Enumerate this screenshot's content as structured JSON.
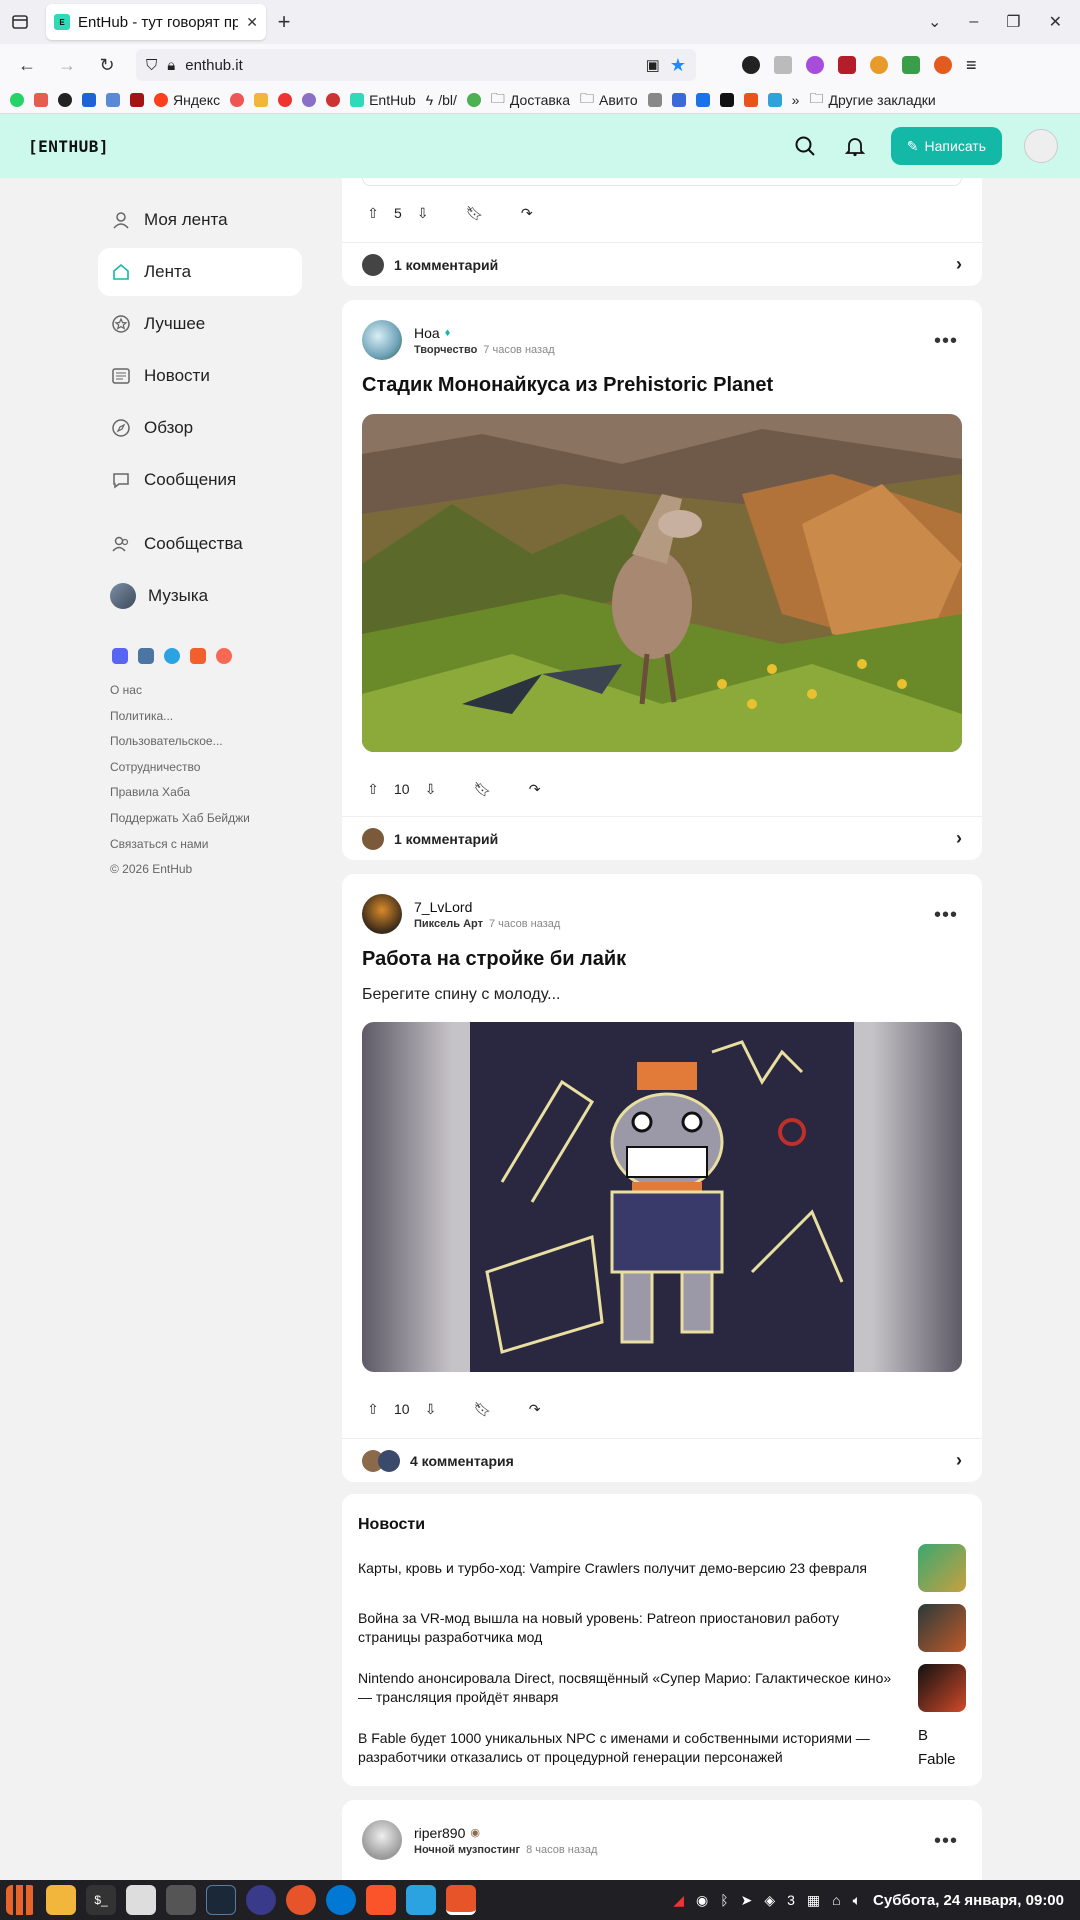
{
  "browser": {
    "tab_title": "EntHub - тут говорят пр",
    "url": "enthub.it",
    "bookmarks": [
      "Яндекс",
      "EntHub",
      "/bl/",
      "Доставка",
      "Авито",
      "Другие закладки"
    ]
  },
  "header": {
    "logo": "[ENTHUB]",
    "write_label": "Написать"
  },
  "sidebar": {
    "items": [
      {
        "label": "Моя лента",
        "icon": "user-feed-icon"
      },
      {
        "label": "Лента",
        "icon": "home-icon"
      },
      {
        "label": "Лучшее",
        "icon": "star-icon"
      },
      {
        "label": "Новости",
        "icon": "newspaper-icon"
      },
      {
        "label": "Обзор",
        "icon": "compass-icon"
      },
      {
        "label": "Сообщения",
        "icon": "message-icon"
      },
      {
        "label": "Сообщества",
        "icon": "people-icon"
      },
      {
        "label": "Музыка",
        "icon": "music-avatar-icon"
      }
    ],
    "footer_links": [
      "О нас",
      "Политика...",
      "Пользовательское...",
      "Сотрудничество",
      "Правила Хаба",
      "Поддержать Хаб",
      "Бейджи",
      "Связаться с нами",
      "© 2026 EntHub"
    ]
  },
  "top_post": {
    "votes": "5",
    "comments": "1 комментарий"
  },
  "posts": [
    {
      "author": "Ноа",
      "hub": "Творчество",
      "time": "7 часов назад",
      "title": "Стадик Мононайкуса из Prehistoric Planet",
      "votes": "10",
      "comments": "1 комментарий"
    },
    {
      "author": "7_LvLord",
      "hub": "Пиксель Арт",
      "time": "7 часов назад",
      "title": "Работа на стройке би лайк",
      "text": "Берегите спину с молоду...",
      "votes": "10",
      "comments": "4 комментария"
    },
    {
      "author": "riper890",
      "hub": "Ночной музпостинг",
      "time": "8 часов назад"
    }
  ],
  "news": {
    "title": "Новости",
    "items": [
      "Карты, кровь и турбо-ход: Vampire Crawlers получит демо-версию 23 февраля",
      "Война за VR-мод вышла на новый уровень: Patreon приостановил работу страницы разработчика мод",
      "Nintendo анонсировала Direct, посвящённый «Супер Марио: Галактическое кино» — трансляция пройдёт января",
      "В Fable будет 1000 уникальных NPC с именами и собственными историями — разработчики отказались от процедурной генерации персонажей"
    ],
    "last_thumb_alt": "В Fable"
  },
  "taskbar": {
    "workspace": "3",
    "clock": "Суббота, 24 января, 09:00"
  },
  "colors": {
    "accent": "#14b8a6",
    "header_bg": "#cdf8ec"
  }
}
